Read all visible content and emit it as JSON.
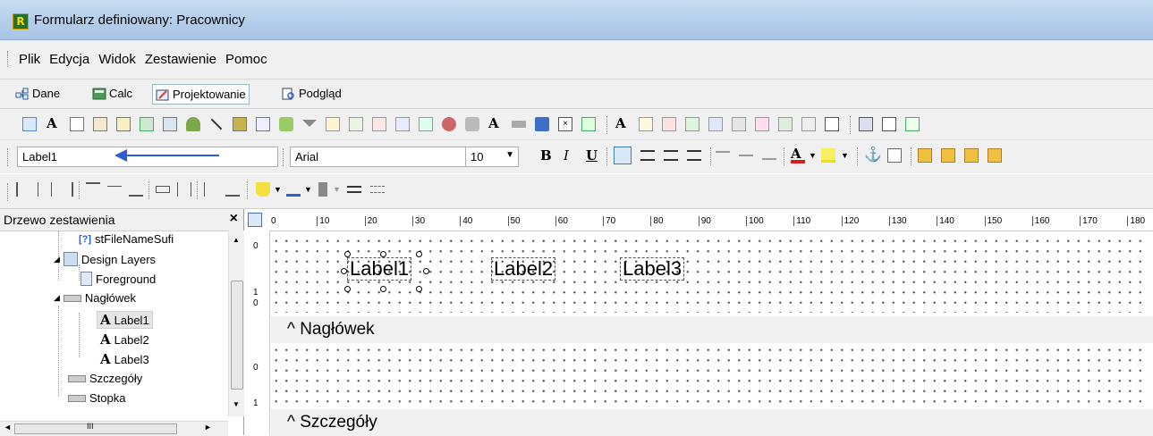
{
  "window": {
    "title": "Formularz definiowany: Pracownicy",
    "icon": "app-logo-icon"
  },
  "menu": [
    "Plik",
    "Edycja",
    "Widok",
    "Zestawienie",
    "Pomoc"
  ],
  "tabs": [
    {
      "label": "Dane",
      "icon": "data-icon"
    },
    {
      "label": "Calc",
      "icon": "calc-icon"
    },
    {
      "label": "Projektowanie",
      "icon": "design-icon",
      "active": true
    },
    {
      "label": "Podgląd",
      "icon": "preview-icon"
    }
  ],
  "component_name": "Label1",
  "font": {
    "name": "Arial",
    "size": "10"
  },
  "format_buttons": {
    "bold": "B",
    "italic": "I",
    "underline": "U"
  },
  "tree": {
    "header": "Drzewo zestawienia",
    "close": "×",
    "items": [
      {
        "label": "stFileNameSufi",
        "icon": "variable-icon"
      },
      {
        "label": "Design Layers",
        "icon": "layers-icon"
      },
      {
        "label": "Foreground",
        "icon": "page-icon"
      },
      {
        "label": "Nagłówek",
        "icon": "band-icon"
      },
      {
        "label": "Label1",
        "icon": "label-icon"
      },
      {
        "label": "Label2",
        "icon": "label-icon"
      },
      {
        "label": "Label3",
        "icon": "label-icon"
      },
      {
        "label": "Szczegóły",
        "icon": "band-icon"
      },
      {
        "label": "Stopka",
        "icon": "band-icon"
      }
    ],
    "hscroll_grip": "III"
  },
  "ruler": {
    "ticks": [
      "0",
      "10",
      "20",
      "30",
      "40",
      "50",
      "60",
      "70",
      "80",
      "90",
      "100",
      "110",
      "120",
      "130",
      "140",
      "150",
      "160",
      "170",
      "180"
    ]
  },
  "ruler_left": {
    "header_marks": [
      "0",
      "1",
      "0"
    ],
    "detail_marks": [
      "0",
      "1"
    ]
  },
  "design": {
    "labels": [
      "Label1",
      "Label2",
      "Label3"
    ],
    "bands": [
      {
        "caret": "^",
        "title": "Nagłówek"
      },
      {
        "caret": "^",
        "title": "Szczegóły"
      }
    ]
  }
}
